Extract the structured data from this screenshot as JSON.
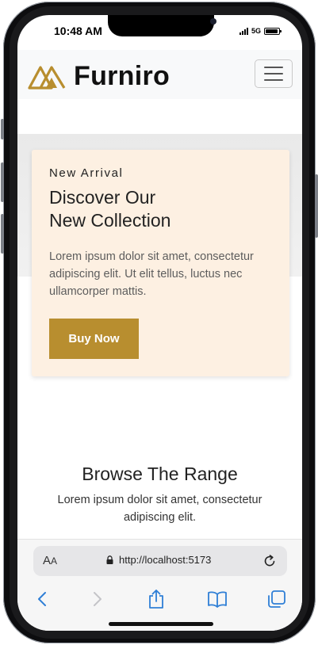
{
  "status_bar": {
    "time": "10:48 AM",
    "network": "5G"
  },
  "navbar": {
    "brand": "Furniro",
    "logo_color": "#b88e2f"
  },
  "hero": {
    "label": "New Arrival",
    "title_line1": "Discover Our",
    "title_line2": "New Collection",
    "description": "Lorem ipsum dolor sit amet, consectetur adipiscing elit. Ut elit tellus, luctus nec ullamcorper mattis.",
    "button_label": "Buy Now",
    "accent_color": "#b88e2f",
    "card_color": "#fdf0e2"
  },
  "range": {
    "title": "Browse The Range",
    "description": "Lorem ipsum dolor sit amet, consectetur adipiscing elit."
  },
  "browser": {
    "reader_label_big": "A",
    "reader_label_small": "A",
    "url": "http://localhost:5173",
    "icons": [
      "back-icon",
      "forward-icon",
      "share-icon",
      "bookmarks-icon",
      "tabs-icon"
    ],
    "icon_color": "#2f7fd6"
  }
}
